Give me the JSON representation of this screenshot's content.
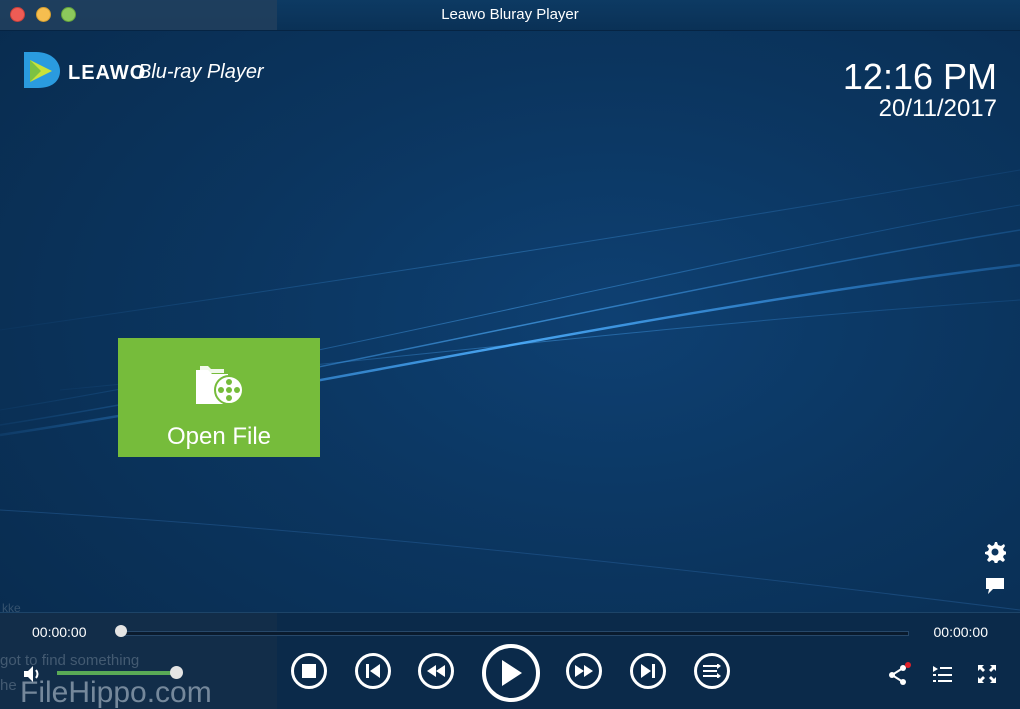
{
  "window": {
    "title": "Leawo Bluray Player"
  },
  "brand": {
    "name": "LEAWO",
    "product": "Blu-ray Player"
  },
  "clock": {
    "time": "12:16 PM",
    "date": "20/11/2017"
  },
  "open_file": {
    "label": "Open File"
  },
  "playback": {
    "current_time": "00:00:00",
    "total_time": "00:00:00",
    "progress": 0,
    "volume": 1.0
  },
  "colors": {
    "background": "#0b355f",
    "accent_green": "#76bc3b",
    "volume_green": "#5aaa56"
  },
  "icons": {
    "settings": "gear-icon",
    "subtitle": "speech-bubble-icon",
    "volume": "speaker-icon",
    "stop": "stop-icon",
    "previous": "skip-previous-icon",
    "rewind": "rewind-icon",
    "play": "play-icon",
    "forward": "fast-forward-icon",
    "next": "skip-next-icon",
    "mode": "playback-mode-icon",
    "share": "share-icon",
    "playlist": "playlist-icon",
    "fullscreen": "fullscreen-icon"
  },
  "background_overlay": {
    "line1": "got to find something",
    "line2": "he",
    "watermark": "FileHippo.com",
    "fragment": "kke"
  }
}
